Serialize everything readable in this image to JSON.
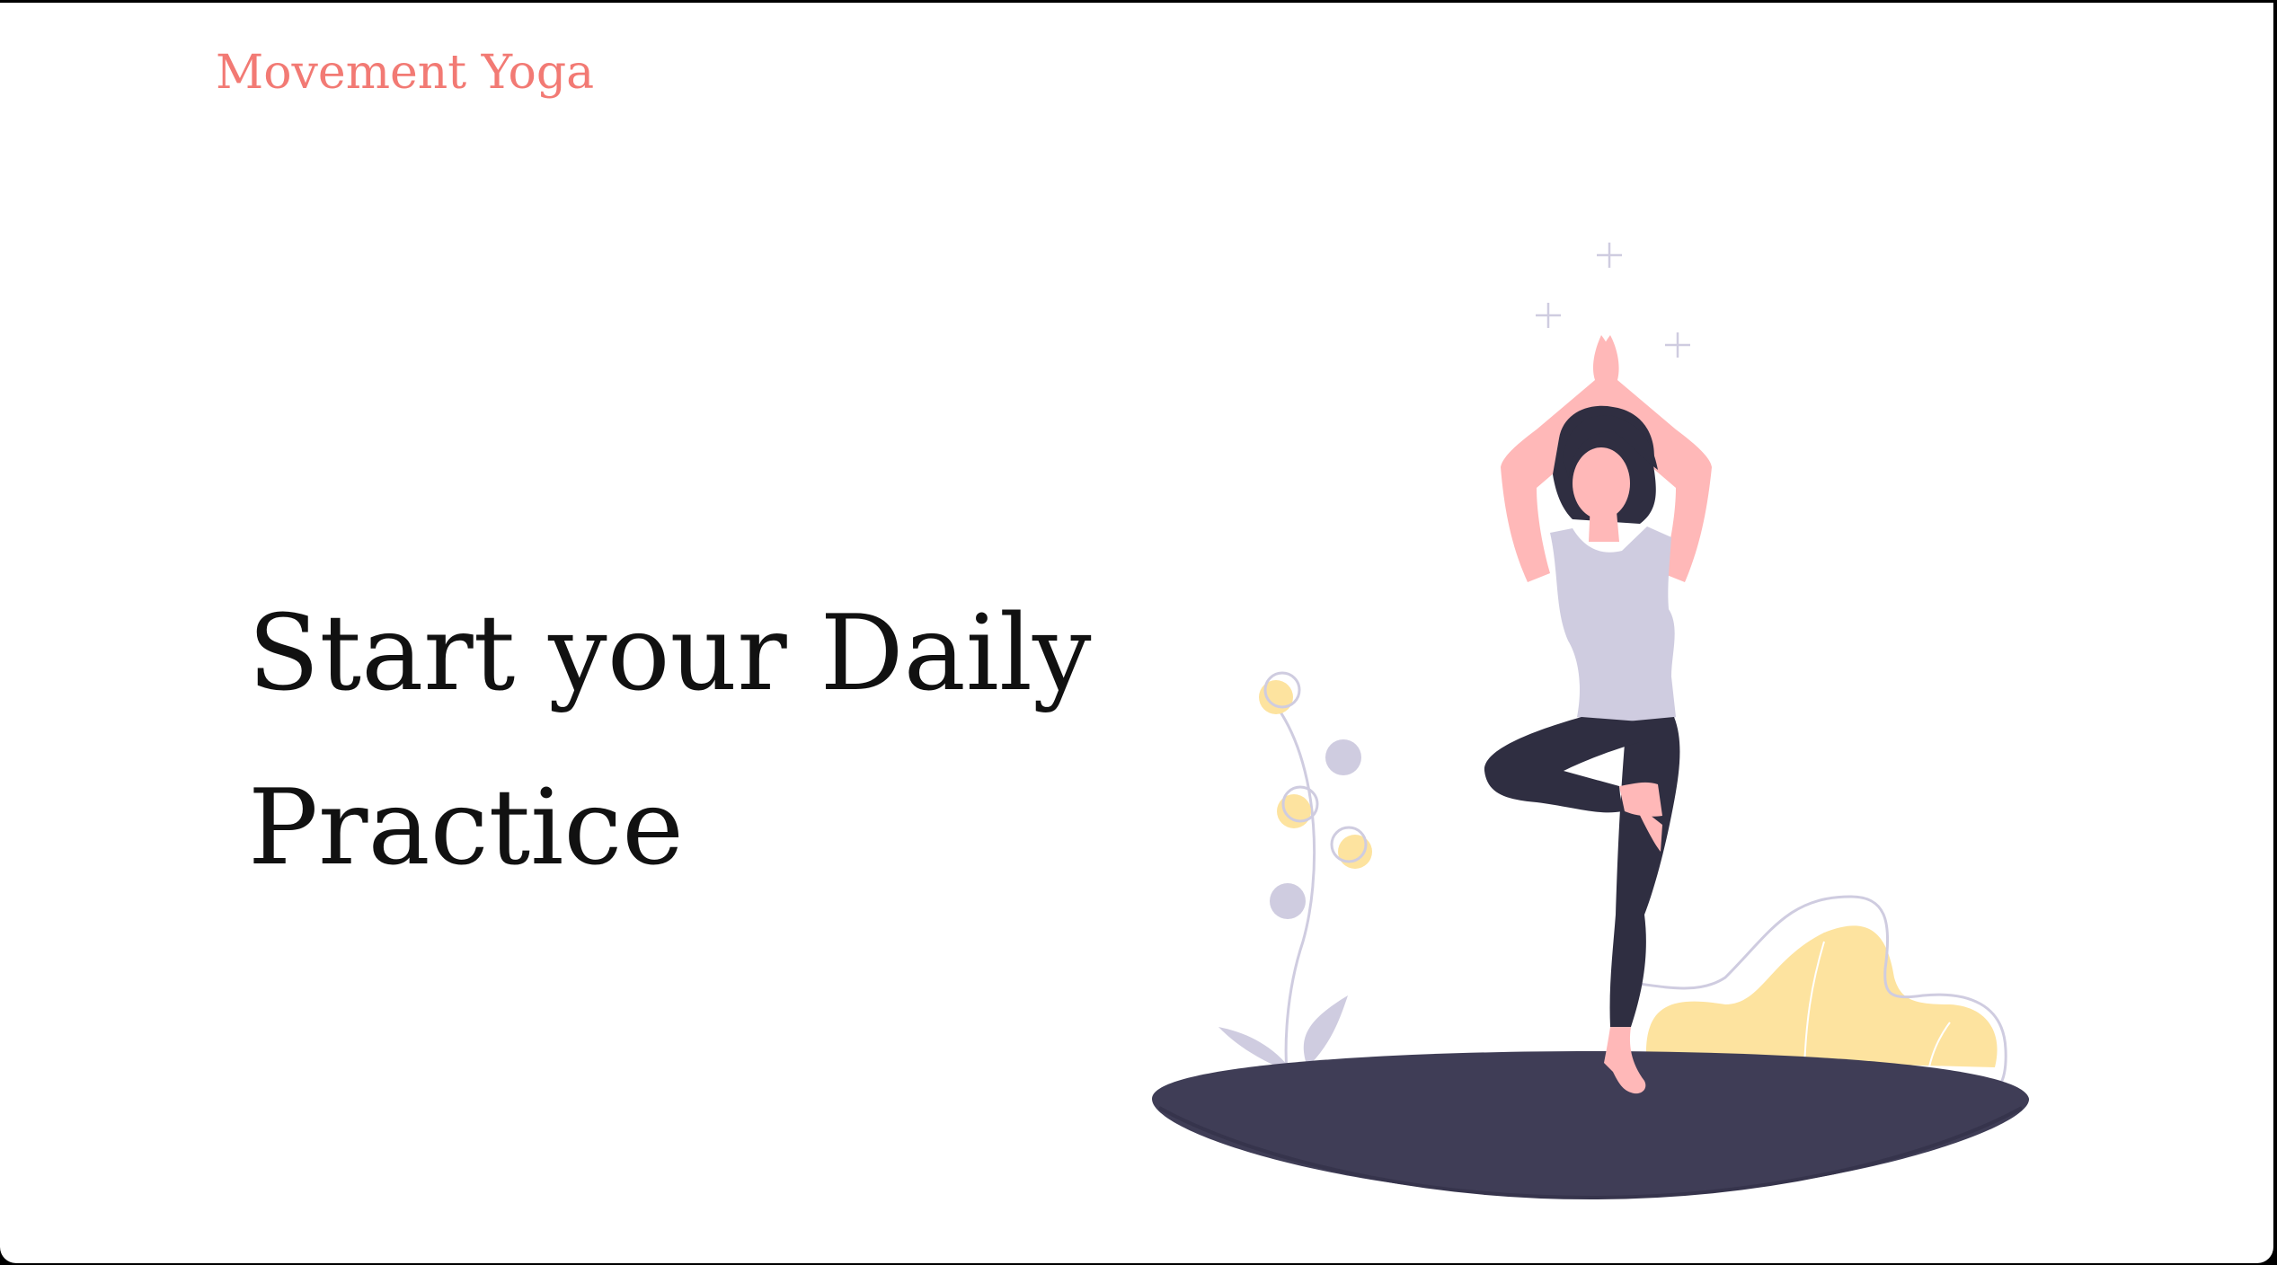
{
  "header": {
    "brand": "Movement Yoga"
  },
  "hero": {
    "title": "Start your Daily Practice"
  },
  "illustration": {
    "icon": "yoga-tree-pose-illustration"
  },
  "colors": {
    "brand": "#f27a74",
    "heading": "#111111",
    "background": "#ffffff",
    "mat": "#3f3d56",
    "skin": "#ffb8b8",
    "hair": "#2f2e41",
    "top": "#cfcce0",
    "pants": "#2f2e41",
    "bush": "#fde39f",
    "plant_line": "#cfcce0"
  }
}
